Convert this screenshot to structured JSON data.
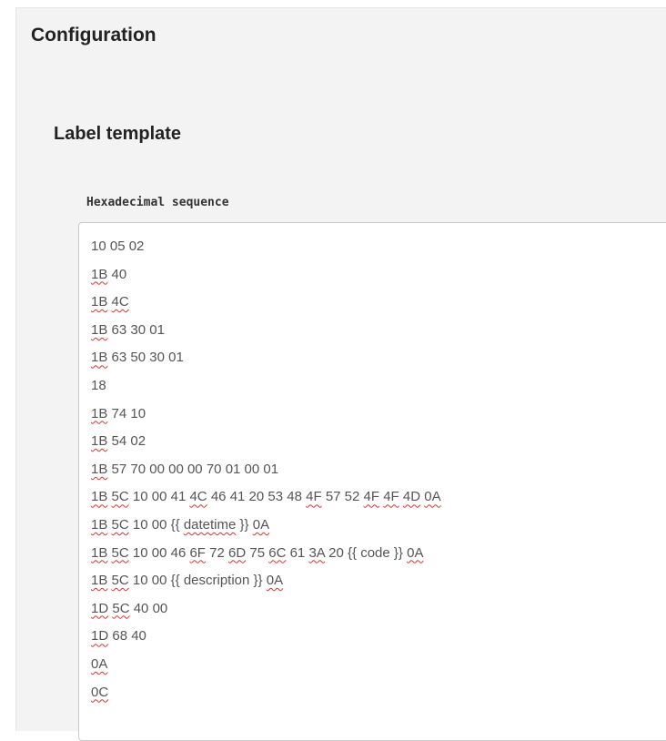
{
  "panel": {
    "title": "Configuration"
  },
  "section": {
    "title": "Label template"
  },
  "field": {
    "label": "Hexadecimal sequence",
    "lines": [
      "10 05 02",
      "1B 40",
      "1B 4C",
      "1B 63 30 01",
      "1B 63 50 30 01",
      "18",
      "1B 74 10",
      "1B 54 02",
      "1B 57 70 00 00 00 70 01 00 01",
      "1B 5C 10 00 41 4C 46 41 20 53 48 4F 57 52 4F 4F 4D 0A",
      "1B 5C 10 00 {{ datetime }} 0A",
      "1B 5C 10 00 46 6F 72 6D 75 6C 61 3A 20 {{ code }} 0A",
      "1B 5C 10 00 {{ description }} 0A",
      "1D 5C 40 00",
      "1D 68 40",
      "0A",
      "0C"
    ]
  },
  "colors": {
    "panel_background": "#f3f3f3",
    "editor_background": "#ffffff",
    "editor_border": "#c9c9c9",
    "heading_text": "#222222",
    "body_text": "#555555",
    "spellcheck_underline": "#e03030"
  }
}
